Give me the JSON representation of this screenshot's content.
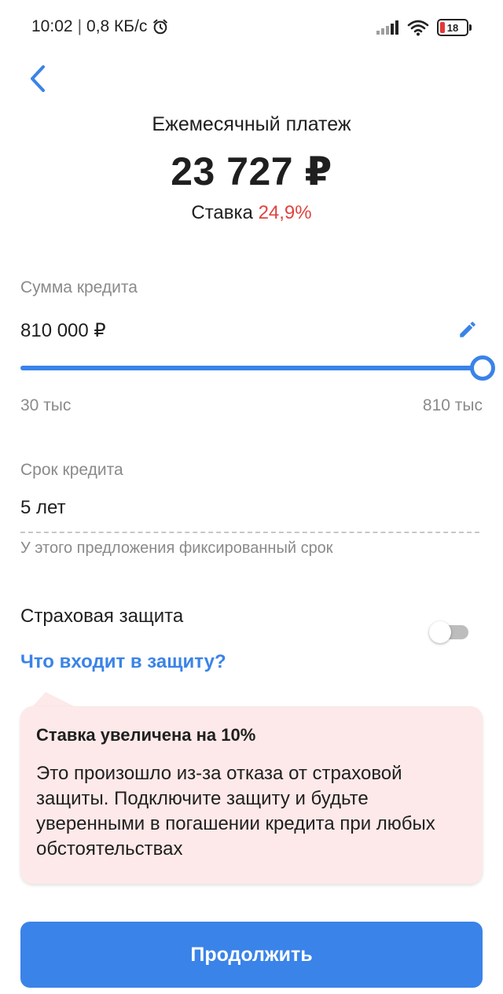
{
  "status_bar": {
    "time": "10:02",
    "separator": "|",
    "network_speed": "0,8 КБ/с",
    "alarm_icon": "alarm-clock-icon",
    "signal_icon": "signal-bars-icon",
    "wifi_icon": "wifi-icon",
    "battery_level": "18",
    "battery_color": "#e53935"
  },
  "header": {
    "back_icon": "chevron-left-icon"
  },
  "payment": {
    "title": "Ежемесячный платеж",
    "amount": "23 727 ₽",
    "rate_label": "Ставка",
    "rate_value": "24,9%",
    "rate_color": "#e0433f"
  },
  "loan_amount": {
    "label": "Сумма кредита",
    "value": "810 000 ₽",
    "edit_icon": "pencil-icon",
    "slider_position": 1.0,
    "min_label": "30 тыс",
    "max_label": "810 тыс"
  },
  "loan_term": {
    "label": "Срок кредита",
    "value": "5 лет",
    "hint": "У этого предложения фиксированный срок"
  },
  "insurance": {
    "label": "Страховая защита",
    "enabled": false,
    "link": "Что входит в защиту?"
  },
  "notice": {
    "title": "Ставка увеличена на 10%",
    "text": "Это произошло из-за отказа от страховой защиты. Подключите защиту и будьте уверенными в погашении кредита при любых обстоятельствах",
    "background": "#fde9e9"
  },
  "actions": {
    "continue_label": "Продолжить",
    "accent": "#3a83e8"
  }
}
